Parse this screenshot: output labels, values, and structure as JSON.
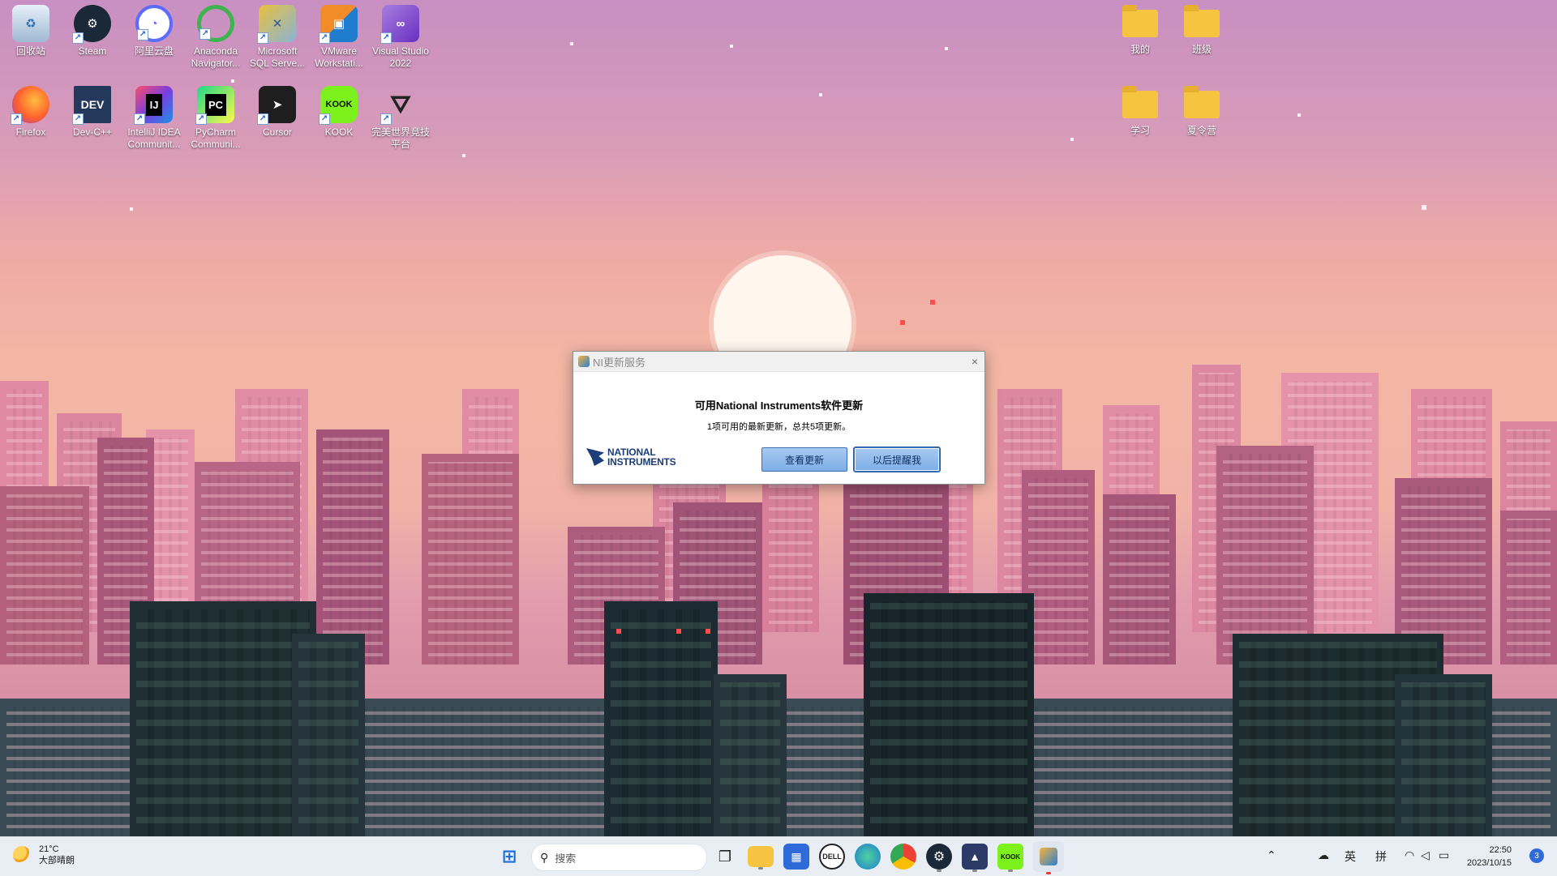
{
  "desktop": {
    "icons_left": [
      {
        "label": "回收站",
        "icon": "recycle-bin-icon"
      },
      {
        "label": "Steam",
        "icon": "steam-icon"
      },
      {
        "label": "阿里云盘",
        "icon": "aliyun-drive-icon"
      },
      {
        "label": "Anaconda Navigator...",
        "icon": "anaconda-icon"
      },
      {
        "label": "Microsoft SQL Serve...",
        "icon": "sql-server-icon"
      },
      {
        "label": "VMware Workstati...",
        "icon": "vmware-icon"
      },
      {
        "label": "Visual Studio 2022",
        "icon": "visual-studio-icon"
      },
      {
        "label": "Firefox",
        "icon": "firefox-icon"
      },
      {
        "label": "Dev-C++",
        "icon": "dev-cpp-icon"
      },
      {
        "label": "IntelliJ IDEA Communit...",
        "icon": "intellij-icon"
      },
      {
        "label": "PyCharm Communi...",
        "icon": "pycharm-icon"
      },
      {
        "label": "Cursor",
        "icon": "cursor-icon"
      },
      {
        "label": "KOOK",
        "icon": "kook-icon"
      },
      {
        "label": "完美世界竞技平台",
        "icon": "perfect-world-icon"
      }
    ],
    "icons_right": [
      {
        "label": "我的",
        "icon": "folder-icon"
      },
      {
        "label": "班级",
        "icon": "folder-icon"
      },
      {
        "label": "学习",
        "icon": "folder-icon"
      },
      {
        "label": "夏令营",
        "icon": "folder-icon"
      }
    ]
  },
  "dialog": {
    "title": "NI更新服务",
    "heading": "可用National Instruments软件更新",
    "subtext": "1项可用的最新更新，总共5项更新。",
    "logo_line1": "NATIONAL",
    "logo_line2": "INSTRUMENTS",
    "view_updates_label": "查看更新",
    "remind_later_label": "以后提醒我",
    "close_symbol": "×"
  },
  "taskbar": {
    "weather_temp": "21°C",
    "weather_desc": "大部晴朗",
    "search_placeholder": "搜索",
    "tray_lang": "英",
    "tray_ime": "拼",
    "time": "22:50",
    "date": "2023/10/15",
    "notification_count": "3",
    "apps": [
      "start-icon",
      "task-view-icon",
      "file-explorer-icon",
      "microsoft-store-icon",
      "dell-icon",
      "edge-dev-icon",
      "chrome-icon",
      "steam-icon",
      "cat-app-icon",
      "kook-icon",
      "ni-update-icon"
    ]
  }
}
